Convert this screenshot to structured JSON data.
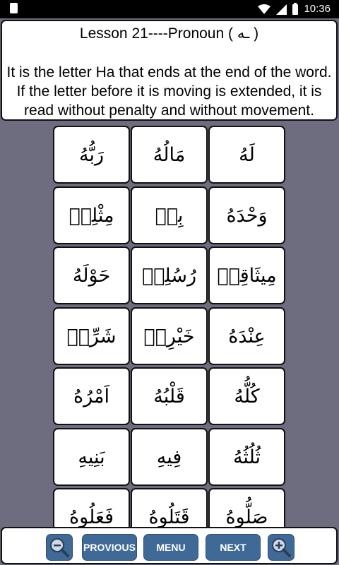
{
  "status_bar": {
    "time": "10:36"
  },
  "lesson": {
    "title": "Lesson 21----Pronoun ( ـه )",
    "description": "It is the letter Ha that ends at the end of the word. If the letter before it is moving is extended, it is read without penalty and without movement."
  },
  "words": [
    [
      "رَبُّهُ",
      "مَالُهُ",
      "لَهُ"
    ],
    [
      "مِثْلِهٖ",
      "بِهٖ",
      "وَحْدَهُ"
    ],
    [
      "حَوْلَهُ",
      "رُسُلِهٖ",
      "مِيثَاقِهٖ"
    ],
    [
      "شَرِّهٖ",
      "خَيْرِهٖ",
      "عِنْدَهُ"
    ],
    [
      "اَمْرُهُ",
      "قَلْبُهُ",
      "كُلُّهُ"
    ],
    [
      "بَنِيهِ",
      "فِيهِ",
      "ثُلُثُهُ"
    ],
    [
      "فَعَلُوهُ",
      "قَتَلُوهُ",
      "صَلُّوهُ"
    ]
  ],
  "nav": {
    "zoom_out": "zoom-out-icon",
    "previous": "PROVIOUS",
    "menu": "MENU",
    "next": "NEXT",
    "zoom_in": "zoom-in-icon"
  },
  "colors": {
    "background": "#6e6d80",
    "button": "#3f6a97"
  }
}
